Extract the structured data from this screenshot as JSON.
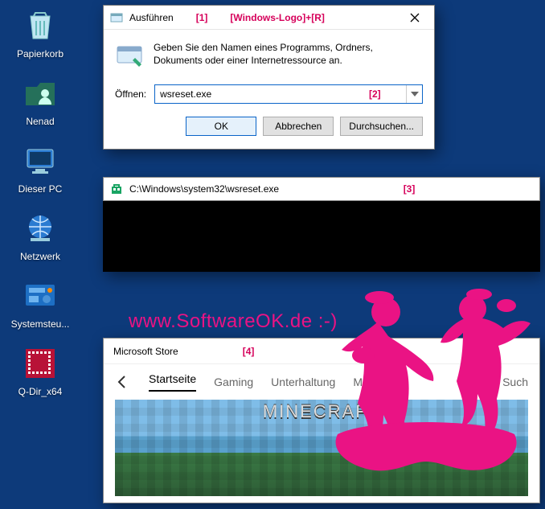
{
  "desktop": {
    "items": [
      {
        "label": "Papierkorb",
        "icon": "recycle-bin-icon"
      },
      {
        "label": "Nenad",
        "icon": "user-folder-icon"
      },
      {
        "label": "Dieser PC",
        "icon": "this-pc-icon"
      },
      {
        "label": "Netzwerk",
        "icon": "network-icon"
      },
      {
        "label": "Systemsteu...",
        "icon": "control-panel-icon"
      },
      {
        "label": "Q-Dir_x64",
        "icon": "qdir-icon"
      }
    ]
  },
  "run": {
    "title": "Ausführen",
    "annotation_step": "[1]",
    "annotation_shortcut": "[Windows-Logo]+[R]",
    "message": "Geben Sie den Namen eines Programms, Ordners, Dokuments oder einer Internetressource an.",
    "open_label": "Öffnen:",
    "input_value": "wsreset.exe",
    "input_annotation": "[2]",
    "buttons": {
      "ok": "OK",
      "cancel": "Abbrechen",
      "browse": "Durchsuchen..."
    }
  },
  "console": {
    "title": "C:\\Windows\\system32\\wsreset.exe",
    "annotation": "[3]"
  },
  "watermark": "www.SoftwareOK.de :-)",
  "store": {
    "title": "Microsoft Store",
    "annotation": "[4]",
    "tabs": [
      "Startseite",
      "Gaming",
      "Unterhaltung",
      "Mehr"
    ],
    "active_tab_index": 0,
    "search_label": "Such",
    "hero_logo": "MINECRAFT"
  }
}
